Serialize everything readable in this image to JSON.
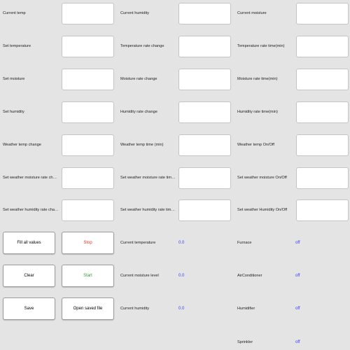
{
  "colors": {
    "background": "#e4e4e4",
    "value_blue": "#3c3cff",
    "stop_red": "#e23a2f",
    "start_green": "#2f9a3a"
  },
  "col1": {
    "current_temp": "Current temp",
    "set_temperature": "Set temperature",
    "set_moisture": "Set moisture",
    "set_humidity": "Set humidity",
    "weather_temp_change": "Weather temp change",
    "set_weather_moisture_rate_change": "Set weather moisture rate change",
    "set_weather_humidity_rate_change": "Set weather humidity rate change"
  },
  "col2": {
    "current_humidity": "Current humidity",
    "temperature_rate_change": "Temperature rate change",
    "moisture_rate_change": "Moisture rate change",
    "humidity_rate_change": "Humidity rate change",
    "weather_temp_time": "Weather temp time (min)",
    "set_weather_moisture_rate_time": "Set weather moisture rate time (...",
    "set_weather_humidity_rate_time": "Set weather humidity rate time (..."
  },
  "col3": {
    "current_moisture": "Current moisture",
    "temperature_rate_time": "Temperature rate time(min)",
    "moisture_rate_time": "Moisture rate time(min)",
    "humidity_rate_time": "Humidity rate time(min)",
    "weather_temp_onoff": "Weather temp On/Off",
    "set_weather_moisture_onoff": "Set weather moisture On/Off",
    "set_weather_humidity_onoff": " Set weather Humidity On/Off"
  },
  "inputs": {
    "current_temp": "",
    "set_temperature": "",
    "set_moisture": "",
    "set_humidity": "",
    "weather_temp_change": "",
    "weather_moisture_rate_change": "",
    "weather_humidity_rate_change": "",
    "current_humidity": "",
    "temperature_rate_change": "",
    "moisture_rate_change": "",
    "humidity_rate_change": "",
    "weather_temp_time": "",
    "weather_moisture_rate_time": "",
    "weather_humidity_rate_time": "",
    "current_moisture": "",
    "temperature_rate_time": "",
    "moisture_rate_time": "",
    "humidity_rate_time": "",
    "weather_temp_onoff": "",
    "weather_moisture_onoff": "",
    "weather_humidity_onoff": ""
  },
  "buttons": {
    "fill_all_values": "Fill all values",
    "stop": "Stop",
    "clear": "Clear",
    "start": "Start",
    "save": "Save",
    "open_saved_file": "Open saved file"
  },
  "status": {
    "current_temperature_label": "Current temperature",
    "current_temperature_value": "0.0",
    "current_moisture_level_label": "Current moisture level",
    "current_moisture_level_value": "0.0",
    "current_humidity_label": "Current humidity",
    "current_humidity_value": "0.0"
  },
  "devices": {
    "furnace_label": "Furnace",
    "furnace_state": "off",
    "airconditioner_label": "AirConditioner",
    "airconditioner_state": "off",
    "humidifier_label": "Humidifier",
    "humidifier_state": "off",
    "sprinkler_label": "Sprinkler",
    "sprinkler_state": "off"
  }
}
